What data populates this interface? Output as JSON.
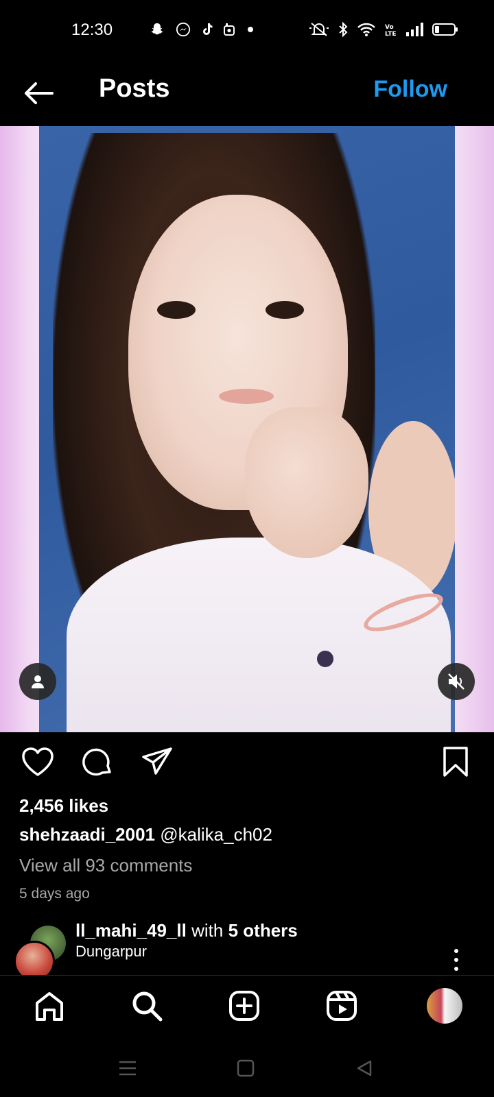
{
  "status_bar": {
    "time": "12:30",
    "notification_icons": [
      "snapchat-icon",
      "messenger-icon",
      "tiktok-icon",
      "instagram-icon",
      "dot-icon"
    ],
    "system_icons": [
      "mute-icon",
      "bluetooth-icon",
      "wifi-icon",
      "volte-icon",
      "signal-icon",
      "battery-icon"
    ]
  },
  "header": {
    "title": "Posts",
    "follow_label": "Follow",
    "accent": "#1d9bf0"
  },
  "post": {
    "likes": "2,456 likes",
    "caption_user": "shehzaadi_2001",
    "caption_text": "@kalika_ch02",
    "view_comments": "View all 93 comments",
    "time_ago": "5 days ago"
  },
  "next_post": {
    "username": "ll_mahi_49_ll",
    "with_text": "with",
    "others": "5 others",
    "location": "Dungarpur"
  },
  "bottom_nav": [
    "home-icon",
    "search-icon",
    "create-icon",
    "reels-icon",
    "profile-avatar"
  ],
  "system_nav": [
    "menu-icon",
    "home-square-icon",
    "back-triangle-icon"
  ]
}
